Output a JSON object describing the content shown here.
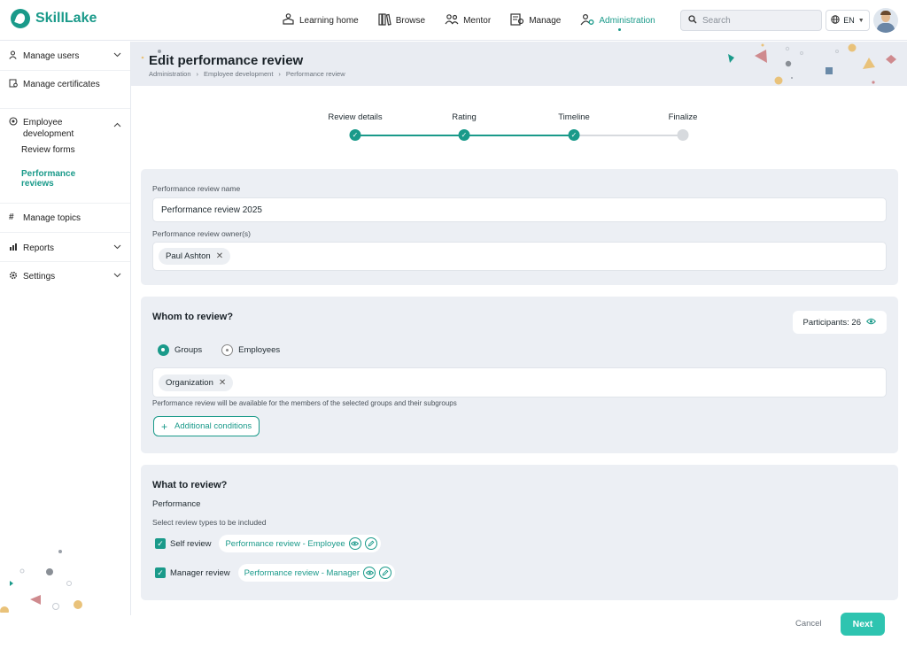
{
  "app": {
    "name": "SkillLake"
  },
  "nav": {
    "items": [
      {
        "label": "Learning home",
        "icon": "learning-home-icon"
      },
      {
        "label": "Browse",
        "icon": "books-icon"
      },
      {
        "label": "Mentor",
        "icon": "mentor-icon"
      },
      {
        "label": "Manage",
        "icon": "manage-icon"
      },
      {
        "label": "Administration",
        "icon": "admin-icon",
        "active": true
      }
    ],
    "search_placeholder": "Search",
    "language": "EN"
  },
  "sidebar": {
    "items": [
      {
        "label": "Manage users"
      },
      {
        "label": "Manage certificates"
      },
      {
        "label": "Employee development"
      },
      {
        "label": "Manage topics"
      },
      {
        "label": "Reports"
      },
      {
        "label": "Settings"
      }
    ],
    "sub_items": [
      {
        "label": "Review forms"
      },
      {
        "label": "Performance reviews",
        "active": true
      }
    ]
  },
  "page": {
    "title": "Edit performance review",
    "breadcrumb": [
      "Administration",
      "Employee development",
      "Performance review"
    ]
  },
  "stepper": {
    "steps": [
      {
        "label": "Review details",
        "done": true
      },
      {
        "label": "Rating",
        "done": true
      },
      {
        "label": "Timeline",
        "done": true
      },
      {
        "label": "Finalize",
        "done": false
      }
    ]
  },
  "details": {
    "name_label": "Performance review name",
    "name_value": "Performance review 2025",
    "owner_label": "Performance review owner(s)",
    "owners": [
      "Paul Ashton"
    ]
  },
  "whom": {
    "title": "Whom to review?",
    "participants_label": "Participants: 26",
    "radio_groups": "Groups",
    "radio_employees": "Employees",
    "selected": "Groups",
    "chips": [
      "Organization"
    ],
    "helper": "Performance review will be available for the members of the selected groups and their subgroups",
    "additional_conditions": "Additional conditions"
  },
  "what": {
    "title": "What to review?",
    "section": "Performance",
    "helper": "Select review types to be included",
    "reviews": [
      {
        "label": "Self review",
        "form": "Performance review - Employee",
        "checked": true
      },
      {
        "label": "Manager review",
        "form": "Performance review - Manager",
        "checked": true
      }
    ]
  },
  "actions": {
    "cancel": "Cancel",
    "next": "Next"
  },
  "colors": {
    "accent": "#1a9a8a",
    "next_button": "#2ec4b0",
    "card_bg": "#eceff4"
  }
}
